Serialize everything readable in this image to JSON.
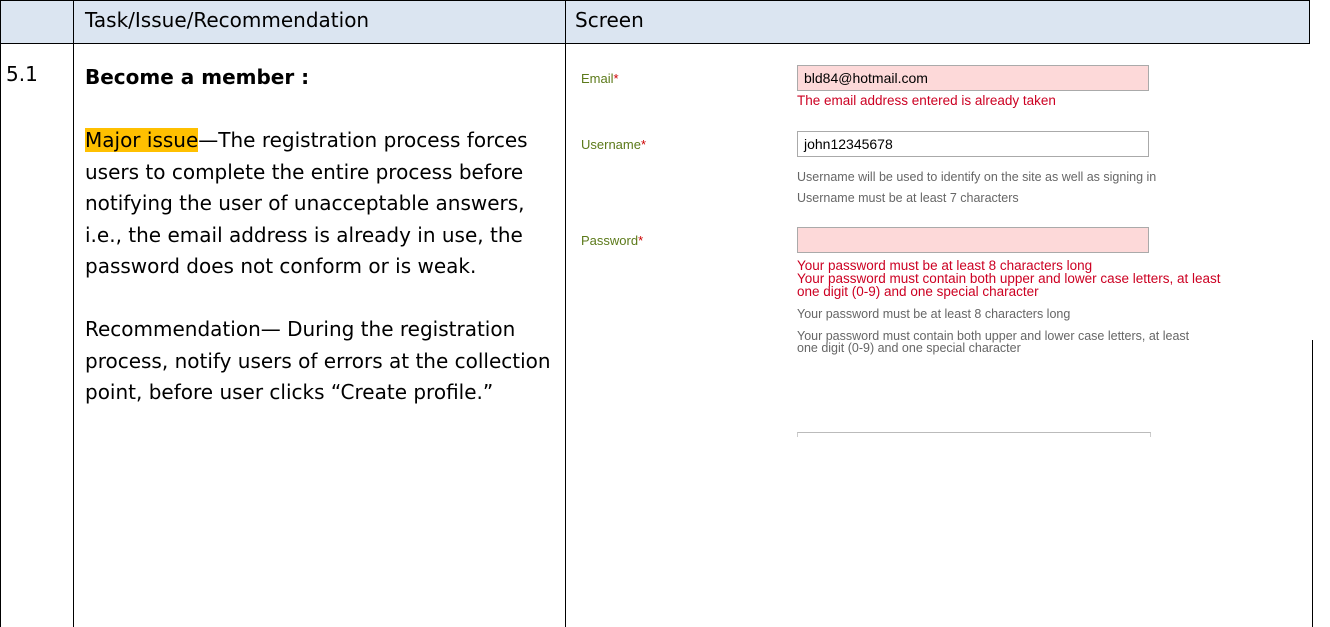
{
  "header": {
    "col_num": "",
    "col_task": "Task/Issue/Recommendation",
    "col_screen": "Screen"
  },
  "row": {
    "number": "5.1",
    "title": "Become a member :",
    "issue_tag": "Major issue",
    "issue_text": "—The registration process forces users to complete the entire process before notifying the user of unacceptable answers, i.e., the email address is already in use, the password does not conform or is weak.",
    "recommendation": "Recommendation— During the registration process, notify users of errors at the collection point, before user clicks “Create profile.”"
  },
  "screen": {
    "email_label": "Email",
    "email_value": "bld84@hotmail.com",
    "email_error": "The email address entered is already taken",
    "username_label": "Username",
    "username_value": "john12345678",
    "username_help_1": "Username will be used to identify on the site as well as signing in",
    "username_help_2": "Username must be at least 7 characters",
    "password_label": "Password",
    "password_value": "",
    "password_error_1": "Your password must be at least 8 characters long",
    "password_error_2a": "Your password must contain both upper and lower case letters, at least",
    "password_error_2b": "one digit (0-9) and one special character",
    "password_help_1": "Your password must be at least 8 characters long",
    "password_help_2a": "Your password must contain both upper and lower case letters, at least",
    "password_help_2b": "one digit (0-9) and one special character",
    "required_mark": "*"
  },
  "colors": {
    "header_bg": "#dbe5f1",
    "highlight": "#ffc000",
    "error_text": "#cc0022",
    "error_field_bg": "#fdd9d9",
    "label_green": "#5c7a1a"
  }
}
